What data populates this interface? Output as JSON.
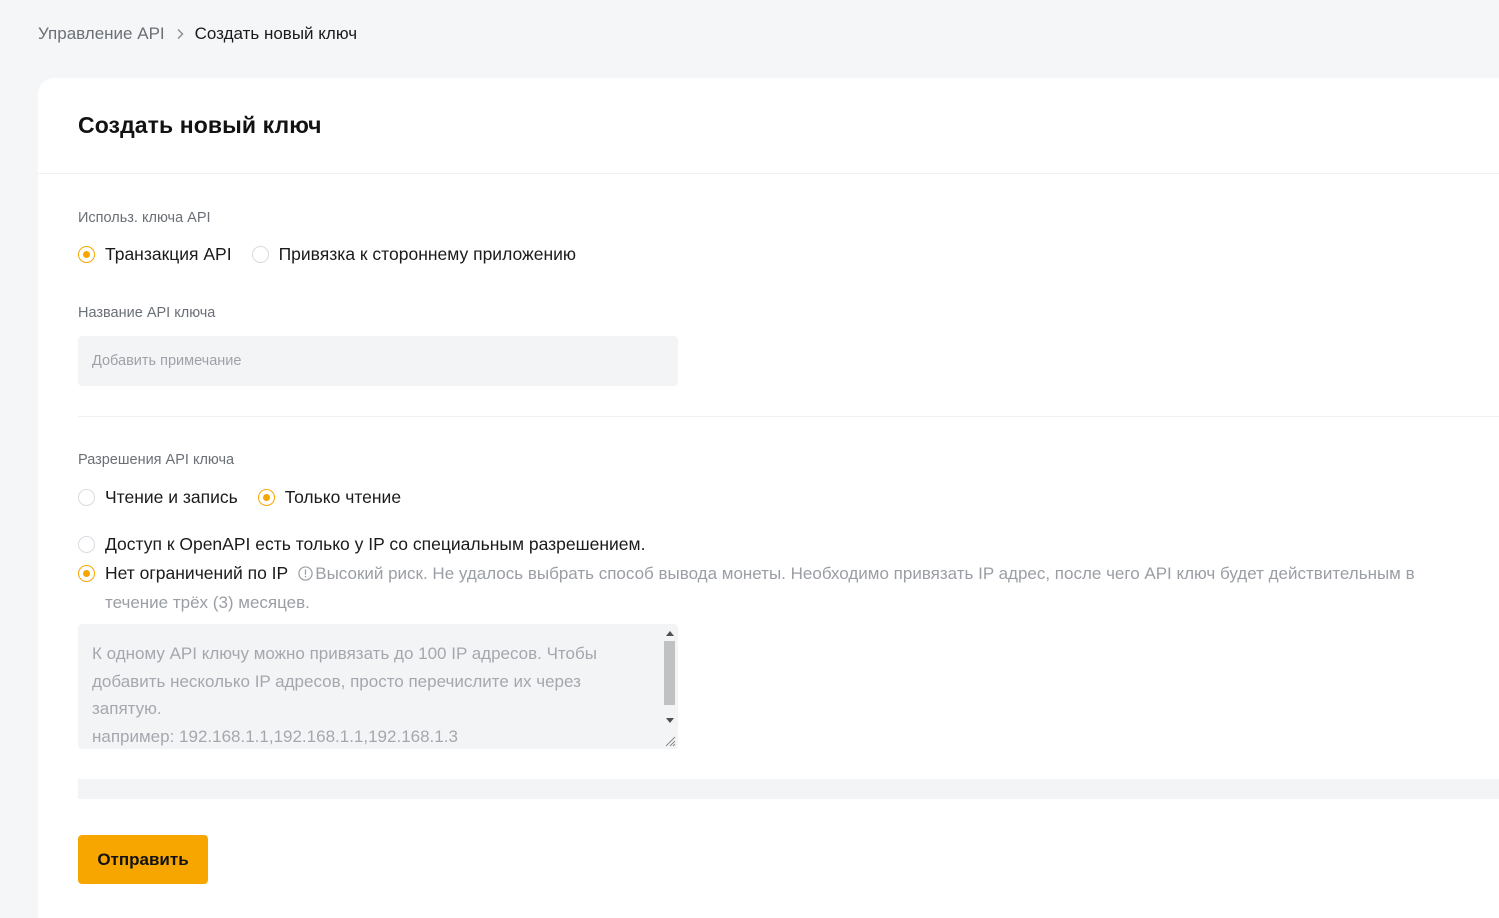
{
  "breadcrumb": {
    "parent": "Управление API",
    "current": "Создать новый ключ"
  },
  "card": {
    "title": "Создать новый ключ"
  },
  "key_usage": {
    "label": "Использ. ключа API",
    "options": [
      {
        "label": "Транзакция API",
        "checked": true
      },
      {
        "label": "Привязка к стороннему приложению",
        "checked": false
      }
    ]
  },
  "key_name": {
    "label": "Название API ключа",
    "value": "",
    "placeholder": "Добавить примечание"
  },
  "permissions": {
    "label": "Разрешения API ключа",
    "options": [
      {
        "label": "Чтение и запись",
        "checked": false
      },
      {
        "label": "Только чтение",
        "checked": true
      }
    ]
  },
  "ip_access": {
    "options": [
      {
        "label": "Доступ к OpenAPI есть только у IP со специальным разрешением.",
        "checked": false
      },
      {
        "label": "Нет ограничений по IP",
        "checked": true
      }
    ],
    "warning": "Высокий риск. Не удалось выбрать способ вывода монеты. Необходимо привязать IP адрес, после чего API ключ будет действительным в течение трёх (3) месяцев.",
    "textarea_placeholder": "К одному API ключу можно привязать до 100 IP адресов. Чтобы добавить несколько IP адресов, просто перечислите их через запятую.\nнапример: 192.168.1.1,192.168.1.1,192.168.1.3"
  },
  "submit_label": "Отправить",
  "colors": {
    "accent": "#f7a600",
    "background": "#f5f6f8",
    "card": "#ffffff",
    "input_bg": "#f3f4f6"
  },
  "icons": [
    "chevron-right-icon",
    "info-icon"
  ]
}
